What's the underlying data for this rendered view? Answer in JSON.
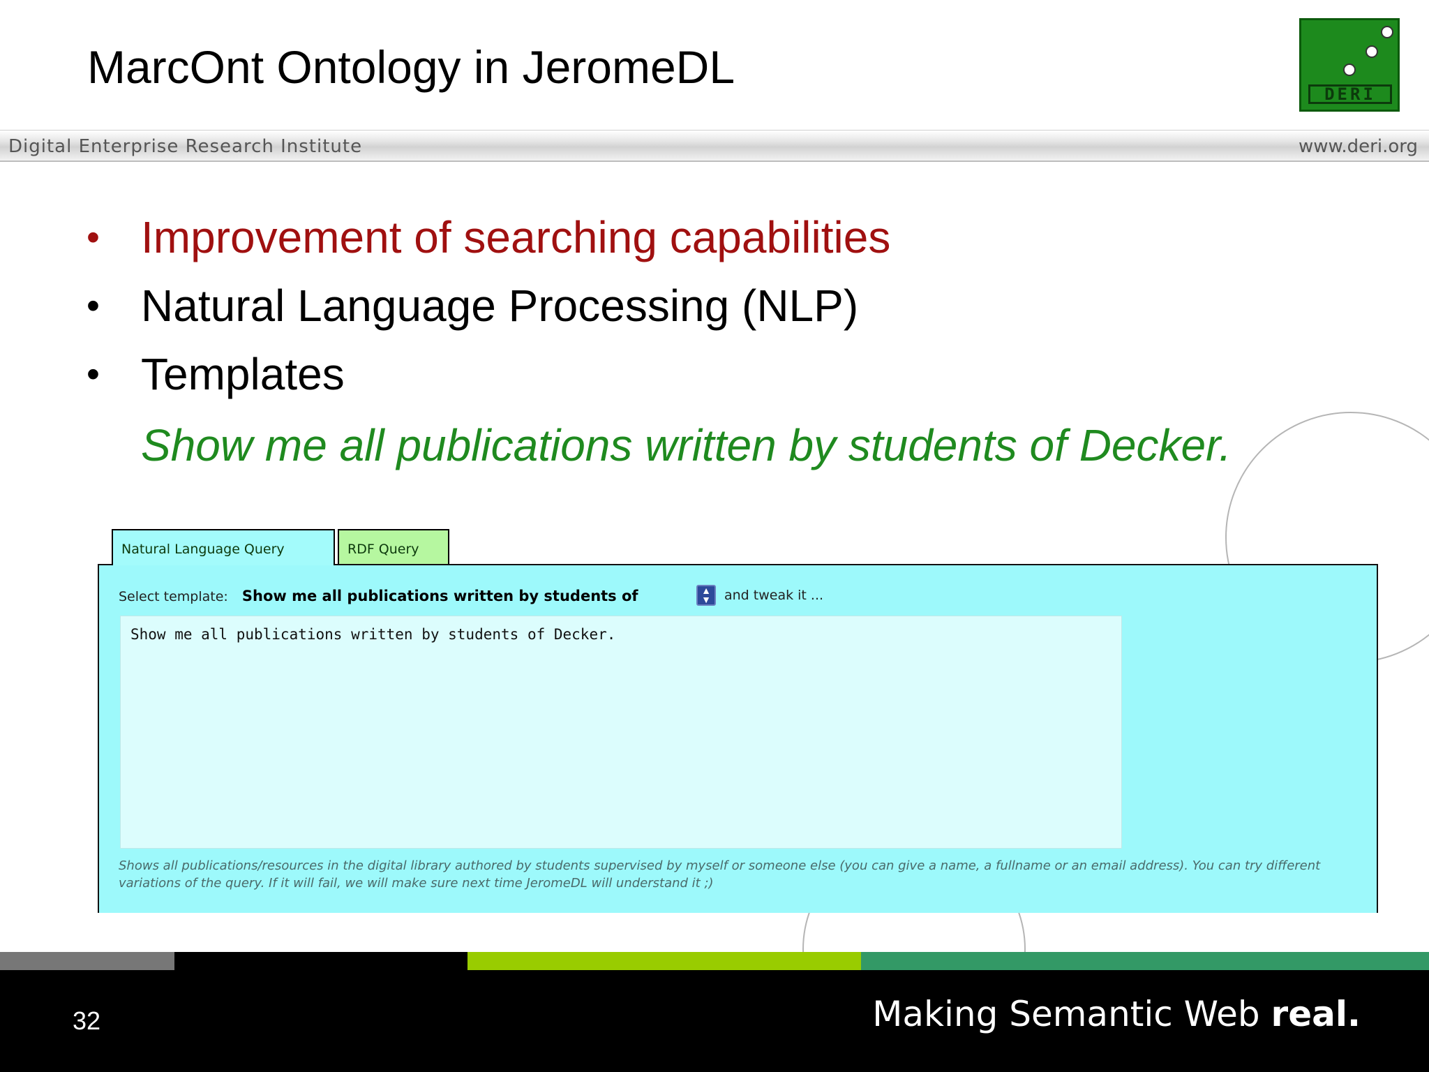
{
  "slide": {
    "title": "MarcOnt Ontology in JeromeDL",
    "page_number": "32",
    "logo_text": "DERI"
  },
  "header": {
    "left_text": "Digital Enterprise Research Institute",
    "right_text": "www.deri.org"
  },
  "bullets": [
    {
      "text": "Improvement of searching capabilities",
      "color": "#a01010"
    },
    {
      "text": "Natural Language Processing (NLP)",
      "color": "#000000"
    },
    {
      "text": "Templates",
      "color": "#000000"
    }
  ],
  "example": {
    "text": "Show me all publications written by students of Decker.",
    "color": "#1f8a1f"
  },
  "query_ui": {
    "tabs": [
      {
        "label": "Natural Language Query",
        "active": true
      },
      {
        "label": "RDF Query",
        "active": false
      }
    ],
    "template_label": "Select template:",
    "template_selected": "Show me all publications written by students of",
    "template_after": "and tweak it ...",
    "query_text": "Show me all publications written by students of Decker.",
    "help_text": "Shows all publications/resources in the digital library authored by students supervised by myself or someone else (you can give a name, a fullname or an email address). You can try different variations of the query. If it will fail, we will make sure next time JeromeDL will understand it ;)",
    "panel_color": "#9df9fb"
  },
  "footer": {
    "slogan_regular": "Making Semantic Web ",
    "slogan_bold": "real.",
    "stripe_colors": [
      "#777777",
      "#000000",
      "#99cc00",
      "#339966"
    ]
  }
}
